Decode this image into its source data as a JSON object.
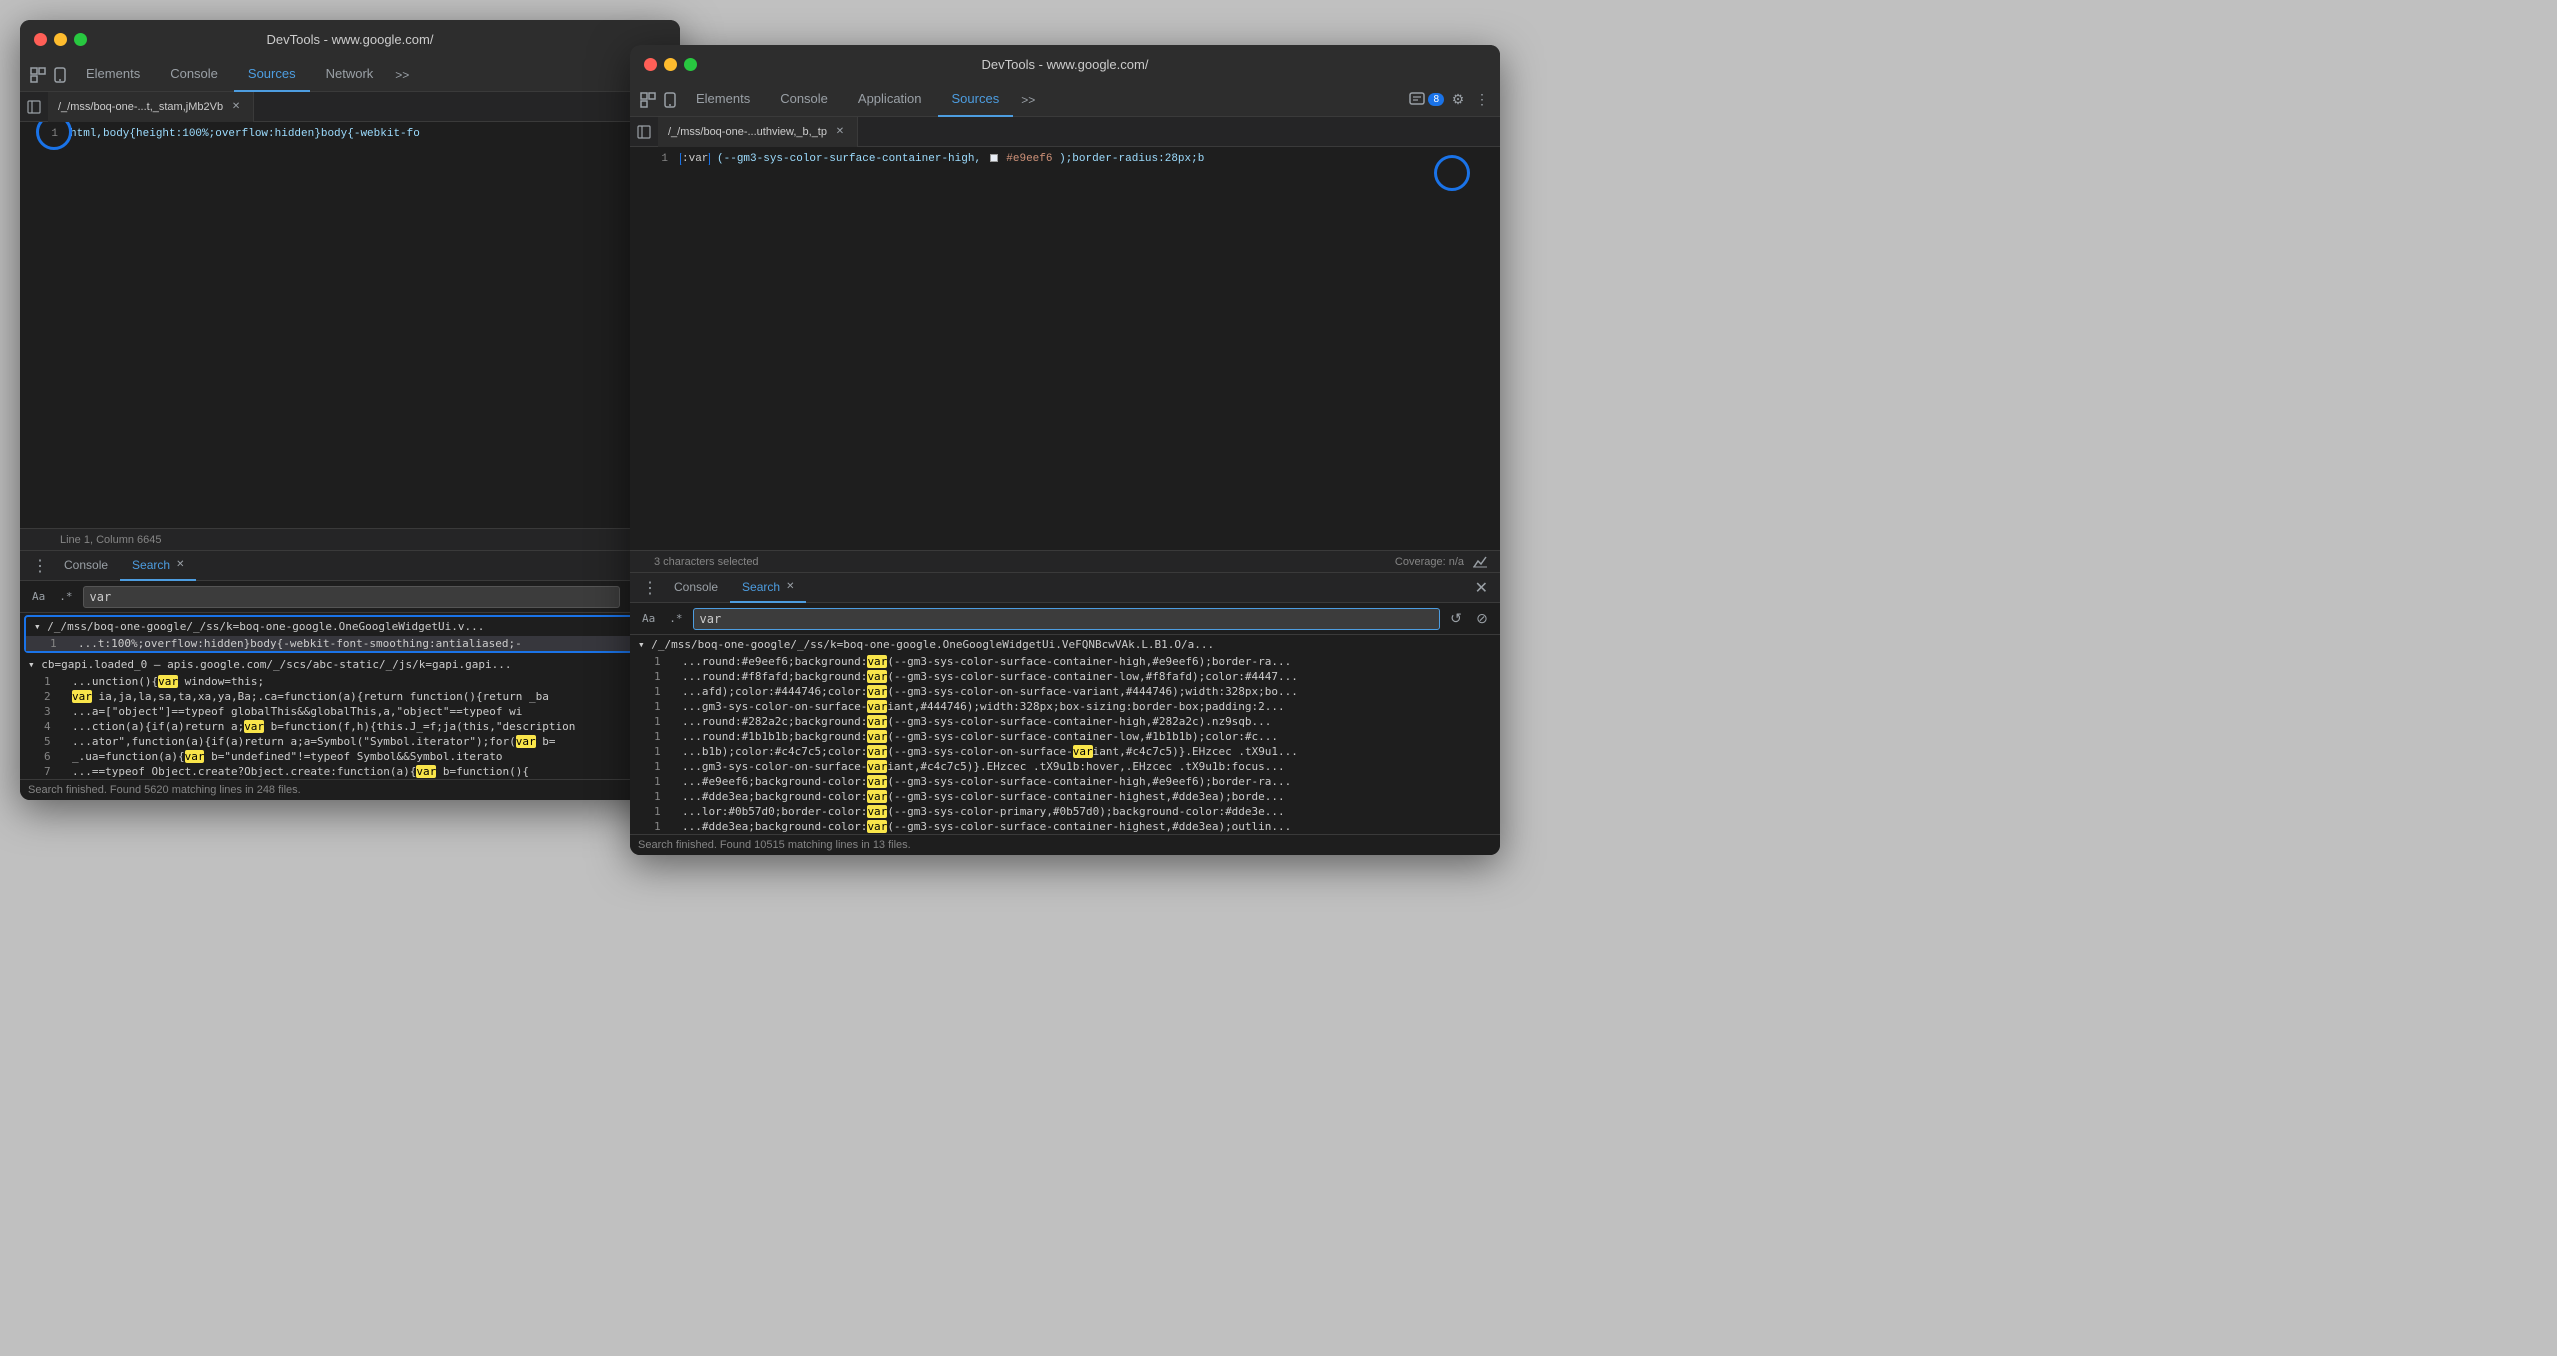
{
  "left_window": {
    "title": "DevTools - www.google.com/",
    "tabs": [
      "Elements",
      "Console",
      "Sources",
      "Network"
    ],
    "active_tab": "Sources",
    "more_tabs": ">>",
    "file_tab": "/_/mss/boq-one-...t,_stam,jMb2Vb",
    "code_line": "html,body{height:100%;overflow:hidden}body{-webkit-fo",
    "status": "Line 1, Column 6645",
    "bottom_tabs": [
      "Console",
      "Search"
    ],
    "active_bottom_tab": "Search",
    "search_options": [
      "Aa",
      ".*"
    ],
    "search_value": "var",
    "search_placeholder": "Search",
    "results_file1": "▾ /_/mss/boq-one-google/_/ss/k=boq-one-google.OneGoogleWidgetUi.v",
    "results_file1_short": "▾ /_/mss/boq-one-google/_/ss/k=boq-one-google.OneGoogleWidgetUi.v...",
    "result_lines": [
      {
        "num": "1",
        "text": "...t:100%;overflow:hidden}body{-webkit-font-smoothing:antialiased;-",
        "selected": true
      },
      {
        "num": "1",
        "text": "...unction(){var window=this;"
      },
      {
        "num": "2",
        "text": "var ia,ja,la,sa,ta,xa,ya,Ba;.ca=function(a){return function(){return _ba"
      },
      {
        "num": "3",
        "text": "...a=[\"object\"]==typeof globalThis&&globalThis,a,\"object\"==typeof wi"
      },
      {
        "num": "4",
        "text": "...ction(a){if(a)return a;var b=function(f,h){this.J_=f;ja(this,\"description"
      },
      {
        "num": "5",
        "text": "...ator\",function(a){if(a)return a;a=Symbol(\"Symbol.iterator\");for(var b="
      },
      {
        "num": "6",
        "text": "_.ua=function(a){var b=\"undefined\"!=typeof Symbol&&Symbol.iterato"
      },
      {
        "num": "7",
        "text": "...==typeof Object.create?Object.create:function(a){var b=function(){"
      }
    ],
    "results_file2": "▾ cb=gapi.loaded_0  —  apis.google.com/_/scs/abc-static/_/js/k=gapi.gapi...",
    "search_status": "Search finished.  Found 5620 matching lines in 248 files."
  },
  "right_window": {
    "title": "DevTools - www.google.com/",
    "tabs": [
      "Elements",
      "Console",
      "Application",
      "Sources"
    ],
    "active_tab": "Sources",
    "more_tabs": ">>",
    "badge": "8",
    "file_tab": "/_/mss/boq-one-...uthview,_b,_tp",
    "code_line_prefix": ":var",
    "code_line_content": "(--gm3-sys-color-surface-container-high,",
    "code_line_color": "#e9eef6",
    "code_line_suffix": ");border-radius:28px;b",
    "status": "3 characters selected",
    "coverage": "Coverage: n/a",
    "bottom_tabs": [
      "Console",
      "Search"
    ],
    "active_bottom_tab": "Search",
    "search_options": [
      "Aa",
      ".*"
    ],
    "search_value": "var",
    "search_placeholder": "Search",
    "results_file": "▾ /_/mss/boq-one-google/_/ss/k=boq-one-google.OneGoogleWidgetUi.VeFQNBcwVAk.L.B1.O/a...",
    "result_lines": [
      {
        "num": "1",
        "text": "...round:#e9eef6;background:var(--gm3-sys-color-surface-container-high,#e9eef6);border-ra..."
      },
      {
        "num": "1",
        "text": "...round:#f8fafd;background:var(--gm3-sys-color-surface-container-low,#f8fafd);color:#4447..."
      },
      {
        "num": "1",
        "text": "...afd);color:#444746;color:var(--gm3-sys-color-on-surface-variant,#444746);width:328px;bo..."
      },
      {
        "num": "1",
        "text": "...gm3-sys-color-on-surface-variant,#444746);width:328px;box-sizing:border-box;padding:2..."
      },
      {
        "num": "1",
        "text": "...round:#282a2c;background:var(--gm3-sys-color-surface-container-high,#282a2c).nz9sqb..."
      },
      {
        "num": "1",
        "text": "...round:#1b1b1b;background:var(--gm3-sys-color-surface-container-low,#1b1b1b);color:#c..."
      },
      {
        "num": "1",
        "text": "...b1b);color:#c4c7c5;color:var(--gm3-sys-color-on-surface-variant,#c4c7c5)}.EHzcec .tX9u1..."
      },
      {
        "num": "1",
        "text": "...gm3-sys-color-on-surface-variant,#c4c7c5)}.EHzcec .tX9u1b:hover,.EHzcec .tX9u1b:focus..."
      },
      {
        "num": "1",
        "text": "...#e9eef6;background-color:var(--gm3-sys-color-surface-container-high,#e9eef6);border-ra..."
      },
      {
        "num": "1",
        "text": "...#dde3ea;background-color:var(--gm3-sys-color-surface-container-highest,#dde3ea);borde..."
      },
      {
        "num": "1",
        "text": "...lor:#0b57d0;border-color:var(--gm3-sys-color-primary,#0b57d0);background-color:#dde3e..."
      },
      {
        "num": "1",
        "text": "...#dde3ea;background-color:var(--gm3-sys-color-surface-container-highest,#dde3ea);outlin..."
      }
    ],
    "search_status": "Search finished.  Found 10515 matching lines in 13 files."
  },
  "icons": {
    "inspect": "⬚",
    "device": "📱",
    "more": "»",
    "close": "✕",
    "refresh": "↺",
    "clear": "⊘",
    "dots": "⋮",
    "collapse": "▾",
    "gear": "⚙",
    "chat": "💬"
  }
}
